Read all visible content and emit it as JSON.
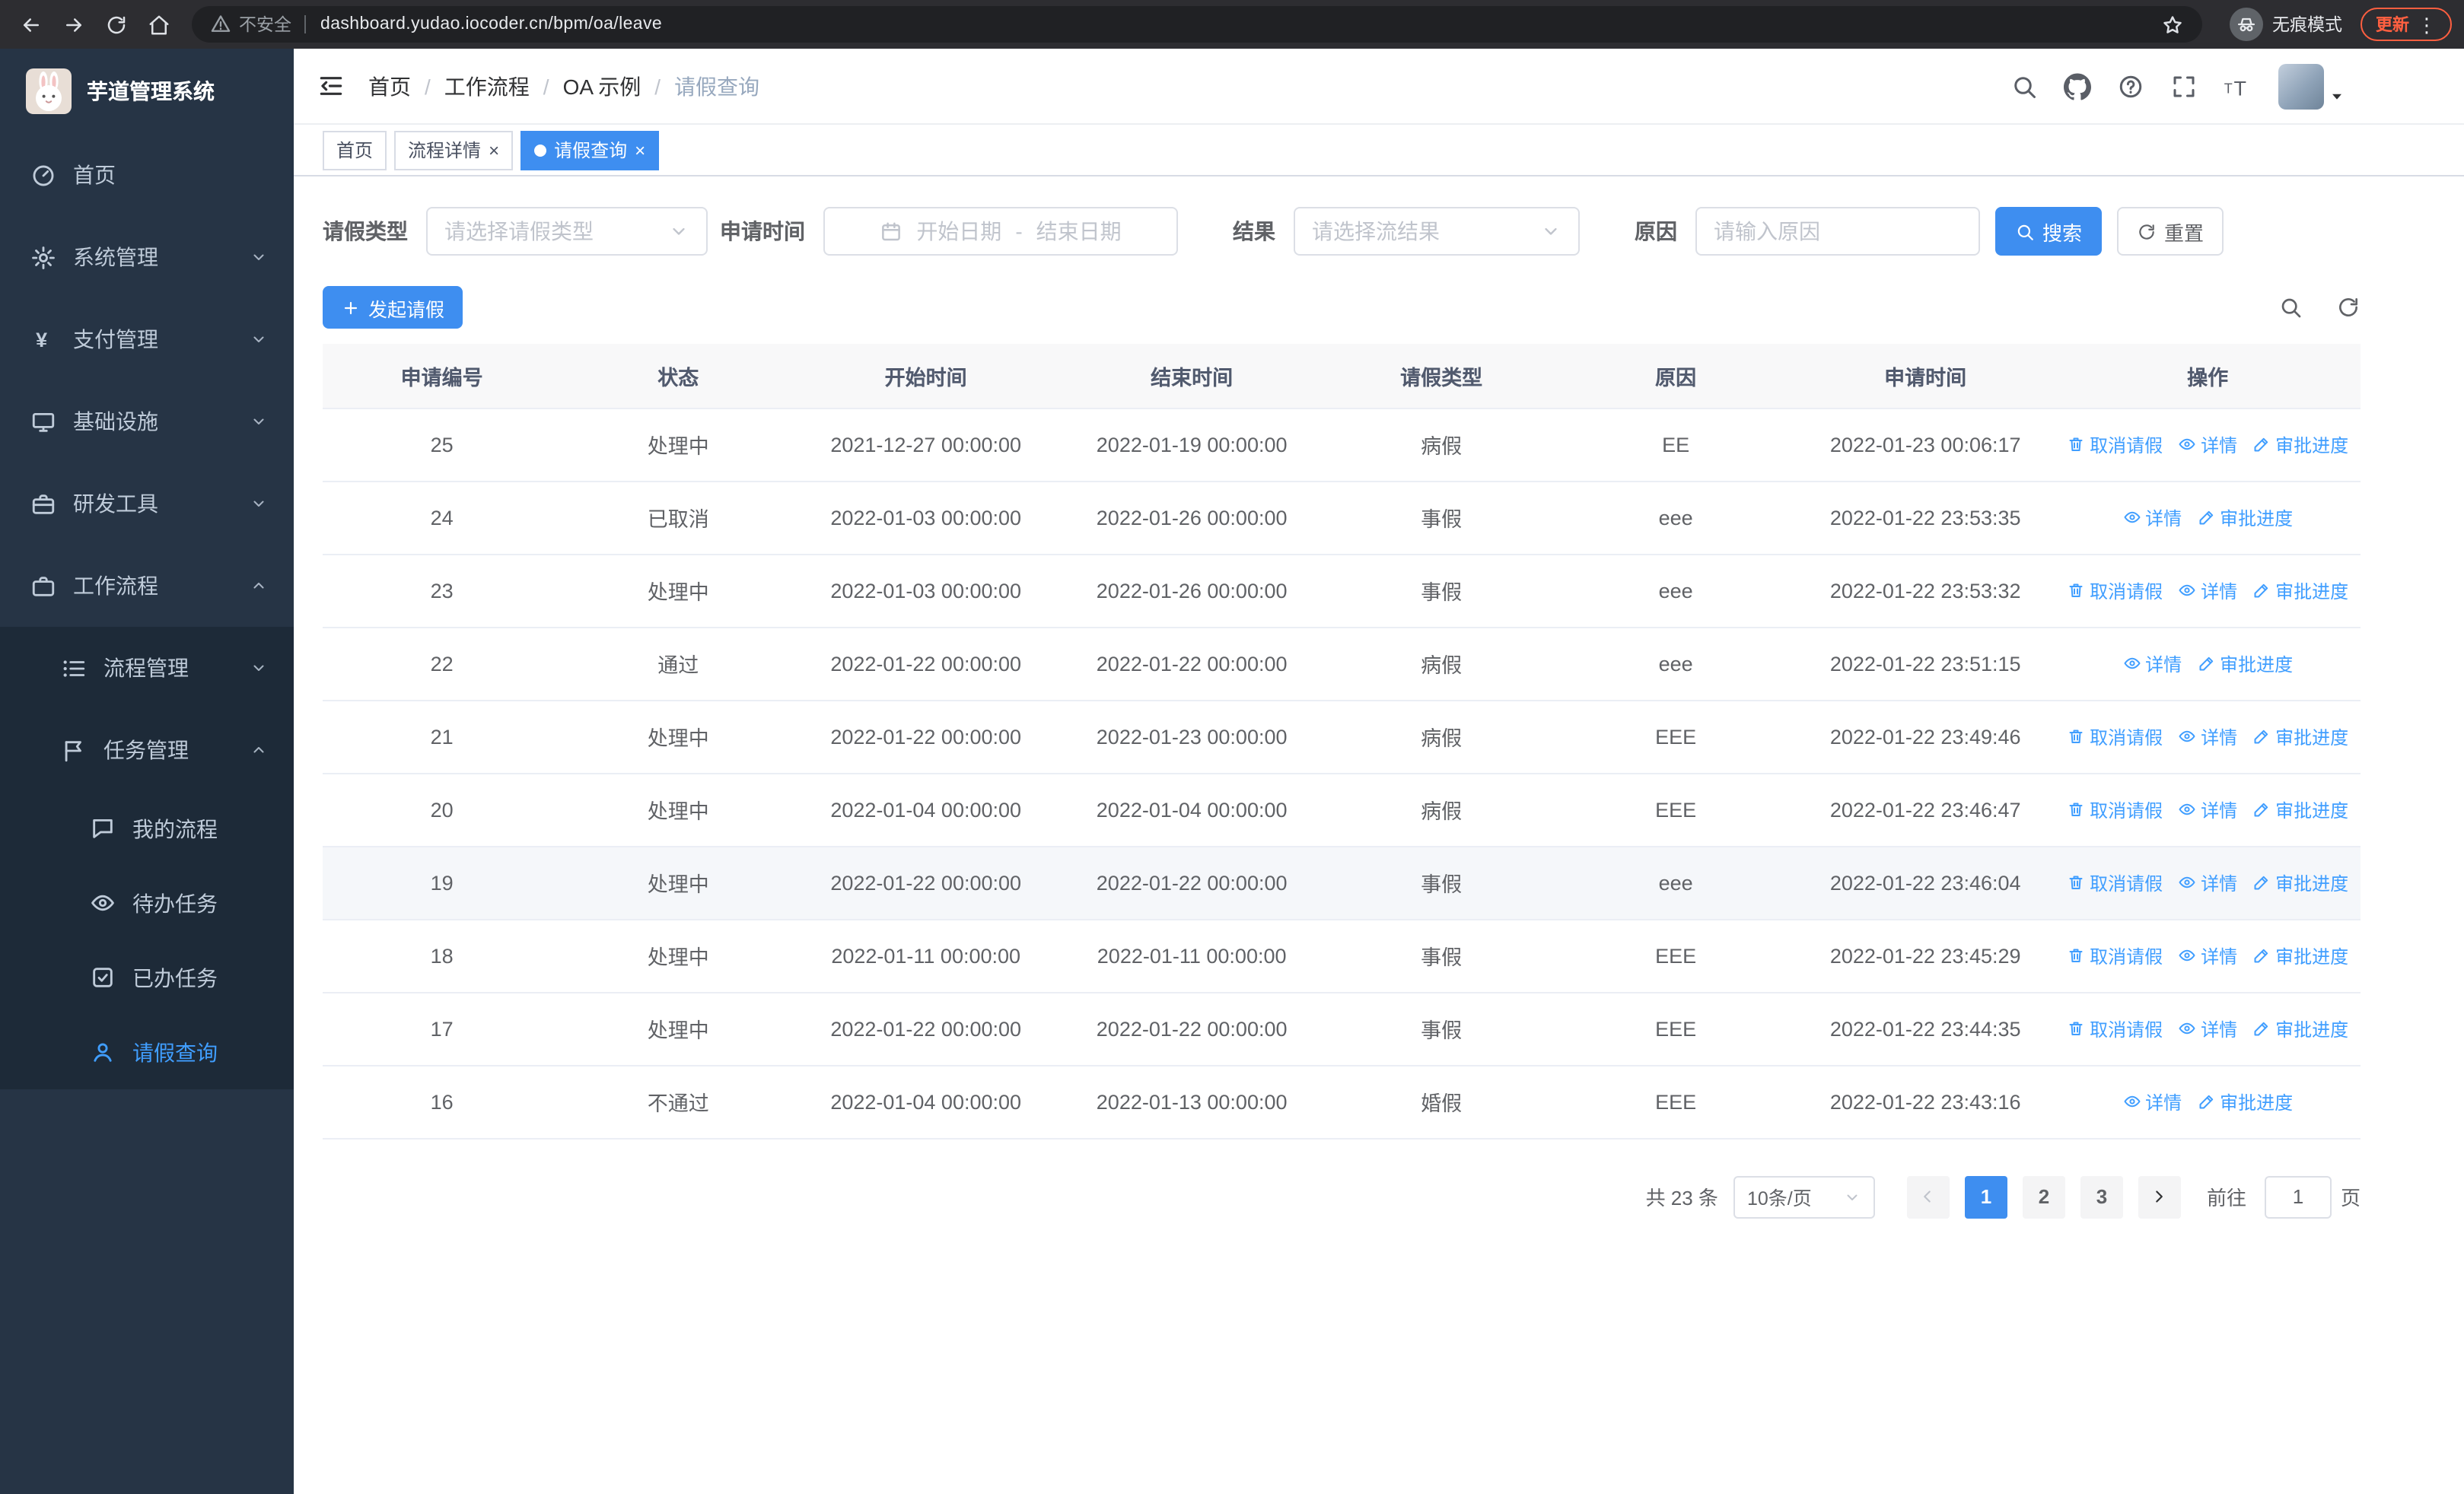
{
  "colors": {
    "primary": "#3e8ef0",
    "link": "#409eff",
    "danger": "#ff5f40",
    "sidebar_bg": "#263445",
    "sidebar_sub_bg": "#1d2a38",
    "sidebar_text": "#bfcbd9"
  },
  "browser": {
    "security_label": "不安全",
    "url": "dashboard.yudao.iocoder.cn/bpm/oa/leave",
    "incognito_label": "无痕模式",
    "update_label": "更新",
    "menu_glyph": "⋮"
  },
  "sidebar": {
    "logo_title": "芋道管理系统",
    "items": [
      {
        "label": "首页",
        "icon": "dashboard-icon",
        "level": 1
      },
      {
        "label": "系统管理",
        "icon": "gear-icon",
        "level": 1,
        "arrow": "down"
      },
      {
        "label": "支付管理",
        "icon": "yen-icon",
        "level": 1,
        "arrow": "down"
      },
      {
        "label": "基础设施",
        "icon": "monitor-icon",
        "level": 1,
        "arrow": "down"
      },
      {
        "label": "研发工具",
        "icon": "toolbox-icon",
        "level": 1,
        "arrow": "down"
      },
      {
        "label": "工作流程",
        "icon": "briefcase-icon",
        "level": 1,
        "arrow": "up"
      },
      {
        "label": "流程管理",
        "icon": "list-icon",
        "level": 2,
        "arrow": "down",
        "sub": true
      },
      {
        "label": "任务管理",
        "icon": "flag-icon",
        "level": 2,
        "arrow": "up",
        "sub": true
      },
      {
        "label": "我的流程",
        "icon": "chat-icon",
        "level": 3,
        "sub": true
      },
      {
        "label": "待办任务",
        "icon": "eye-icon",
        "level": 3,
        "sub": true
      },
      {
        "label": "已办任务",
        "icon": "done-icon",
        "level": 3,
        "sub": true
      },
      {
        "label": "请假查询",
        "icon": "user-icon",
        "level": 3,
        "sub": true,
        "active": true
      }
    ]
  },
  "header": {
    "breadcrumb": [
      "首页",
      "工作流程",
      "OA 示例",
      "请假查询"
    ]
  },
  "tabs": [
    {
      "label": "首页",
      "closable": false,
      "active": false
    },
    {
      "label": "流程详情",
      "closable": true,
      "active": false
    },
    {
      "label": "请假查询",
      "closable": true,
      "active": true
    }
  ],
  "filters": {
    "leave_type": {
      "label": "请假类型",
      "placeholder": "请选择请假类型"
    },
    "apply_time": {
      "label": "申请时间",
      "start_placeholder": "开始日期",
      "separator": "-",
      "end_placeholder": "结束日期"
    },
    "result": {
      "label": "结果",
      "placeholder": "请选择流结果"
    },
    "reason": {
      "label": "原因",
      "placeholder": "请输入原因"
    },
    "search_label": "搜索",
    "reset_label": "重置"
  },
  "toolbar": {
    "create_label": "发起请假"
  },
  "table": {
    "columns": [
      "申请编号",
      "状态",
      "开始时间",
      "结束时间",
      "请假类型",
      "原因",
      "申请时间",
      "操作"
    ],
    "action_labels": {
      "cancel": "取消请假",
      "detail": "详情",
      "progress": "审批进度"
    },
    "rows": [
      {
        "id": "25",
        "status": "处理中",
        "start": "2021-12-27 00:00:00",
        "end": "2022-01-19 00:00:00",
        "type": "病假",
        "reason": "EE",
        "applied": "2022-01-23 00:06:17",
        "actions": [
          "cancel",
          "detail",
          "progress"
        ]
      },
      {
        "id": "24",
        "status": "已取消",
        "start": "2022-01-03 00:00:00",
        "end": "2022-01-26 00:00:00",
        "type": "事假",
        "reason": "eee",
        "applied": "2022-01-22 23:53:35",
        "actions": [
          "detail",
          "progress"
        ]
      },
      {
        "id": "23",
        "status": "处理中",
        "start": "2022-01-03 00:00:00",
        "end": "2022-01-26 00:00:00",
        "type": "事假",
        "reason": "eee",
        "applied": "2022-01-22 23:53:32",
        "actions": [
          "cancel",
          "detail",
          "progress"
        ]
      },
      {
        "id": "22",
        "status": "通过",
        "start": "2022-01-22 00:00:00",
        "end": "2022-01-22 00:00:00",
        "type": "病假",
        "reason": "eee",
        "applied": "2022-01-22 23:51:15",
        "actions": [
          "detail",
          "progress"
        ]
      },
      {
        "id": "21",
        "status": "处理中",
        "start": "2022-01-22 00:00:00",
        "end": "2022-01-23 00:00:00",
        "type": "病假",
        "reason": "EEE",
        "applied": "2022-01-22 23:49:46",
        "actions": [
          "cancel",
          "detail",
          "progress"
        ]
      },
      {
        "id": "20",
        "status": "处理中",
        "start": "2022-01-04 00:00:00",
        "end": "2022-01-04 00:00:00",
        "type": "病假",
        "reason": "EEE",
        "applied": "2022-01-22 23:46:47",
        "actions": [
          "cancel",
          "detail",
          "progress"
        ]
      },
      {
        "id": "19",
        "status": "处理中",
        "start": "2022-01-22 00:00:00",
        "end": "2022-01-22 00:00:00",
        "type": "事假",
        "reason": "eee",
        "applied": "2022-01-22 23:46:04",
        "actions": [
          "cancel",
          "detail",
          "progress"
        ],
        "highlighted": true
      },
      {
        "id": "18",
        "status": "处理中",
        "start": "2022-01-11 00:00:00",
        "end": "2022-01-11 00:00:00",
        "type": "事假",
        "reason": "EEE",
        "applied": "2022-01-22 23:45:29",
        "actions": [
          "cancel",
          "detail",
          "progress"
        ]
      },
      {
        "id": "17",
        "status": "处理中",
        "start": "2022-01-22 00:00:00",
        "end": "2022-01-22 00:00:00",
        "type": "事假",
        "reason": "EEE",
        "applied": "2022-01-22 23:44:35",
        "actions": [
          "cancel",
          "detail",
          "progress"
        ]
      },
      {
        "id": "16",
        "status": "不通过",
        "start": "2022-01-04 00:00:00",
        "end": "2022-01-13 00:00:00",
        "type": "婚假",
        "reason": "EEE",
        "applied": "2022-01-22 23:43:16",
        "actions": [
          "detail",
          "progress"
        ]
      }
    ]
  },
  "pagination": {
    "total_text": "共 23 条",
    "page_size_text": "10条/页",
    "pages": [
      "1",
      "2",
      "3"
    ],
    "active_page": "1",
    "goto_label": "前往",
    "goto_value": "1",
    "goto_suffix": "页"
  }
}
